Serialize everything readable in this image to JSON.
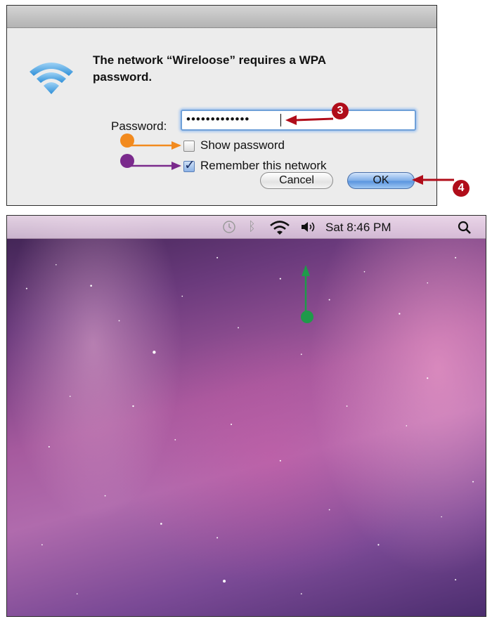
{
  "dialog": {
    "message": "The network “Wireloose” requires a WPA password.",
    "password_label": "Password:",
    "password_value": "•••••••••••••",
    "show_password_label": "Show password",
    "show_password_checked": false,
    "remember_label": "Remember this network",
    "remember_checked": true,
    "cancel_label": "Cancel",
    "ok_label": "OK"
  },
  "menubar": {
    "clock": "Sat 8:46 PM",
    "icons": [
      "time-machine-icon",
      "bluetooth-icon",
      "wifi-icon",
      "volume-icon",
      "spotlight-icon"
    ]
  },
  "callouts": {
    "step_3": "3",
    "step_4": "4",
    "colors": {
      "red": "#b00d1a",
      "orange": "#f28a1e",
      "purple": "#7a2a8c",
      "green": "#1f9a4a"
    }
  }
}
